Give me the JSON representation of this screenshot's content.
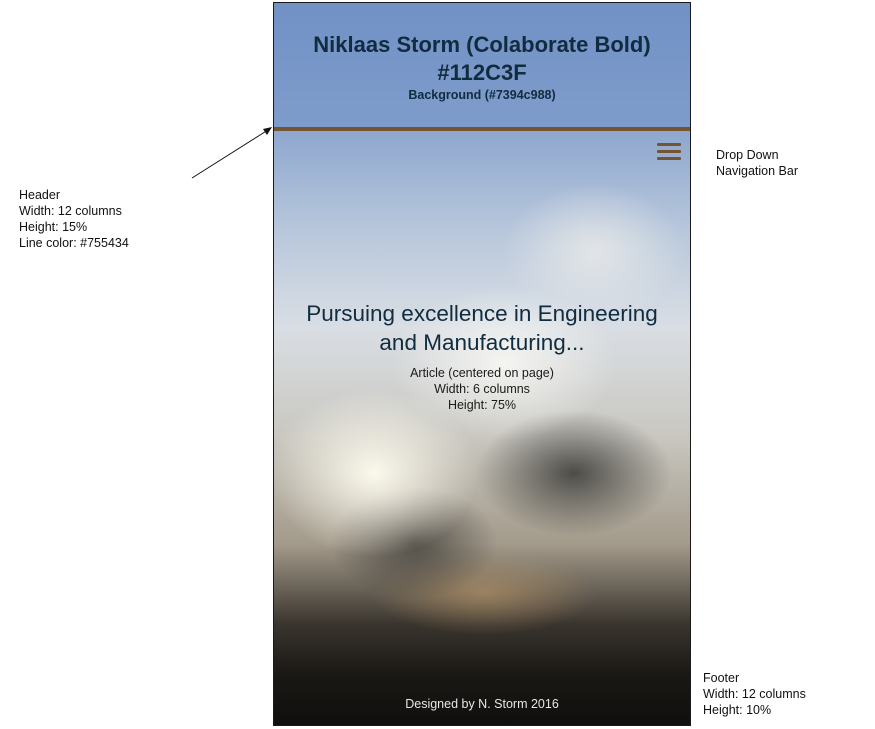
{
  "header": {
    "title_line1": "Niklaas Storm (Colaborate Bold)",
    "title_line2": "#112C3F",
    "background_note": "Background (#7394c988)",
    "background_color": "#7394c988",
    "title_color": "#112C3F",
    "line_color": "#755434"
  },
  "nav": {
    "icon": "hamburger-menu-icon"
  },
  "article": {
    "headline_line1": "Pursuing excellence in Engineering",
    "headline_line2": "and Manufacturing...",
    "note_line1": "Article (centered on page)",
    "note_line2": "Width: 6 columns",
    "note_line3": "Height: 75%"
  },
  "footer": {
    "text": "Designed by N. Storm 2016"
  },
  "annotations": {
    "header": [
      "Header",
      "Width: 12 columns",
      "Height: 15%",
      "Line color: #755434"
    ],
    "nav": [
      "Drop Down",
      "Navigation Bar"
    ],
    "footer": [
      "Footer",
      "Width: 12 columns",
      "Height: 10%"
    ]
  }
}
